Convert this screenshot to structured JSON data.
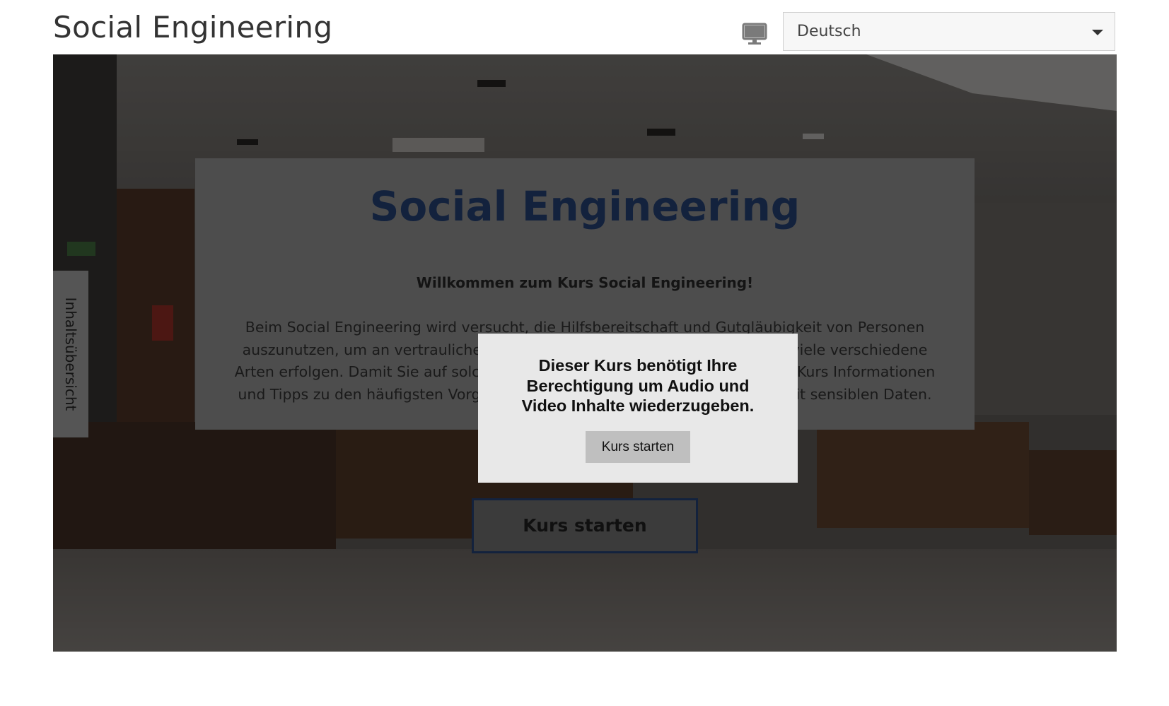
{
  "header": {
    "title": "Social Engineering",
    "device_icon": "desktop-monitor-icon",
    "language_select": {
      "selected": "Deutsch",
      "caret_icon": "caret-down-icon"
    }
  },
  "sidebar": {
    "toc_tab_label": "Inhaltsübersicht"
  },
  "intro": {
    "title": "Social Engineering",
    "subtitle": "Willkommen zum Kurs Social Engineering!",
    "body_lines": [
      "Beim Social Engineering wird versucht, die Hilfsbereitschaft und Gutgläubigkeit von Personen",
      "auszunutzen, um an vertrauliche Informationen zu gelangen. Das kann auf viele verschiedene",
      "Arten erfolgen. Damit Sie auf solche Angriffe reagieren können, bietet dieser Kurs Informationen",
      "und Tipps zu den häufigsten Vorgehensweisen und zum richtigen Umgang mit sensiblen Daten."
    ],
    "start_button_label": "Kurs starten"
  },
  "permission_dialog": {
    "message_lines": [
      "Dieser Kurs benötigt Ihre",
      "Berechtigung um Audio und",
      "Video Inhalte wiederzugeben."
    ],
    "button_label": "Kurs starten"
  },
  "colors": {
    "title_navy": "#13223d",
    "overlay_dim": "rgba(0,0,0,0.55)",
    "dialog_bg": "#e8e8e8",
    "dialog_button_bg": "#bfbfbf"
  }
}
